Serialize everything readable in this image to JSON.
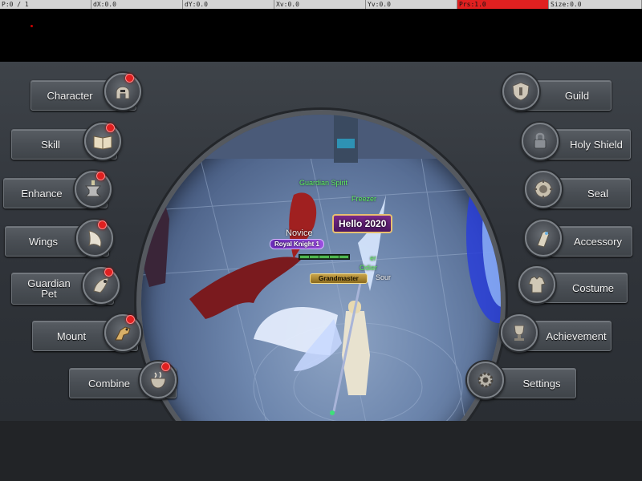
{
  "debug": {
    "pointer": "P:0 / 1",
    "dx": "dX:0.0",
    "dy": "dY:0.0",
    "xv": "Xv:0.0",
    "yv": "Yv:0.0",
    "prs": "Prs:1.0",
    "size": "Size:0.0",
    "prs_color": "#e02020"
  },
  "left_menu": [
    {
      "id": "character",
      "label": "Character",
      "icon": "helmet-icon",
      "notification": true
    },
    {
      "id": "skill",
      "label": "Skill",
      "icon": "book-icon",
      "notification": true
    },
    {
      "id": "enhance",
      "label": "Enhance",
      "icon": "anvil-icon",
      "notification": true
    },
    {
      "id": "wings",
      "label": "Wings",
      "icon": "wing-icon",
      "notification": true
    },
    {
      "id": "guardian-pet",
      "label_line1": "Guardian",
      "label_line2": "Pet",
      "icon": "pet-icon",
      "notification": true
    },
    {
      "id": "mount",
      "label": "Mount",
      "icon": "mount-icon",
      "notification": true
    },
    {
      "id": "combine",
      "label": "Combine",
      "icon": "cauldron-icon",
      "notification": true
    }
  ],
  "right_menu": [
    {
      "id": "guild",
      "label": "Guild",
      "icon": "guild-shield-icon",
      "notification": false
    },
    {
      "id": "holy-shield",
      "label": "Holy Shield",
      "icon": "lock-icon",
      "notification": false
    },
    {
      "id": "seal",
      "label": "Seal",
      "icon": "seal-icon",
      "notification": false
    },
    {
      "id": "accessory",
      "label": "Accessory",
      "icon": "ring-icon",
      "notification": false
    },
    {
      "id": "costume",
      "label": "Costume",
      "icon": "armor-icon",
      "notification": false
    },
    {
      "id": "achievement",
      "label": "Achievement",
      "icon": "trophy-icon",
      "notification": false
    },
    {
      "id": "settings",
      "label": "Settings",
      "icon": "gear-icon",
      "notification": false
    }
  ],
  "scene": {
    "guardian_spirit": "Guardian Spirit",
    "freezer": "Freezer",
    "novice": "Novice",
    "royal_knight": "Royal Knight 1",
    "hello_badge": "Hello 2020",
    "grandmaster": "Grandmaster",
    "side_tag_1": "er",
    "side_tag_2": "Odier",
    "side_tag_3": "Sour"
  },
  "colors": {
    "notification": "#e02020",
    "name_green": "#5ef05e",
    "panel_bg": "#3a3f45"
  }
}
